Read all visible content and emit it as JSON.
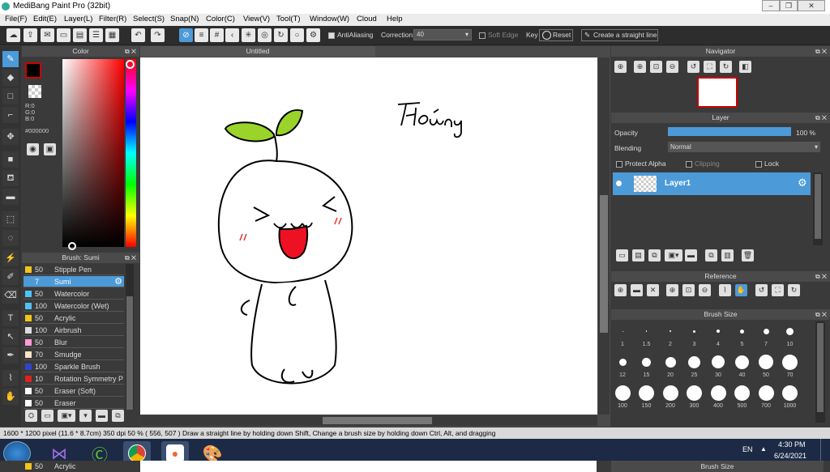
{
  "app": {
    "title": "MediBang Paint Pro (32bit)"
  },
  "menu": [
    "File(F)",
    "Edit(E)",
    "Layer(L)",
    "Filter(R)",
    "Select(S)",
    "Snap(N)",
    "Color(C)",
    "View(V)",
    "Tool(T)",
    "Window(W)",
    "Cloud",
    "Help"
  ],
  "toolbar": {
    "antialiasing_label": "AntiAliasing",
    "correction_label": "Correction",
    "correction_value": "40",
    "soft_edge_label": "Soft Edge",
    "key_label": "Key",
    "reset_label": "Reset",
    "straight_line_label": "Create a straight line"
  },
  "color_panel": {
    "title": "Color",
    "r": "R:0",
    "g": "G:0",
    "b": "B:0",
    "hex": "#000000",
    "primary_color": "#000000"
  },
  "brush_panel": {
    "title": "Brush: Sumi",
    "items": [
      {
        "size": "50",
        "name": "Stipple Pen",
        "color": "#f2c51c"
      },
      {
        "size": "7",
        "name": "Sumi",
        "color": "#4c9ad8",
        "selected": true
      },
      {
        "size": "50",
        "name": "Watercolor",
        "color": "#4fc3f7"
      },
      {
        "size": "100",
        "name": "Watercolor (Wet)",
        "color": "#4fc3f7"
      },
      {
        "size": "50",
        "name": "Acrylic",
        "color": "#f2c51c"
      },
      {
        "size": "100",
        "name": "Airbrush",
        "color": "#dddddd"
      },
      {
        "size": "50",
        "name": "Blur",
        "color": "#ff9bd6"
      },
      {
        "size": "70",
        "name": "Smudge",
        "color": "#ffe3c2"
      },
      {
        "size": "100",
        "name": "Sparkle Brush",
        "color": "#3344cc"
      },
      {
        "size": "10",
        "name": "Rotation Symmetry P",
        "color": "#dd2222"
      },
      {
        "size": "50",
        "name": "Eraser (Soft)",
        "color": "#ffffff"
      },
      {
        "size": "50",
        "name": "Eraser",
        "color": "#ffffff"
      }
    ]
  },
  "canvas": {
    "tab_title": "Untitled",
    "signature_text": "Hoàng"
  },
  "navigator": {
    "title": "Navigator"
  },
  "layer_panel": {
    "title": "Layer",
    "opacity_label": "Opacity",
    "opacity_value": "100 %",
    "opacity_fraction": 1.0,
    "blending_label": "Blending",
    "blending_value": "Normal",
    "protect_alpha_label": "Protect Alpha",
    "clipping_label": "Clipping",
    "lock_label": "Lock",
    "layer_name": "Layer1"
  },
  "reference": {
    "title": "Reference"
  },
  "brush_size": {
    "title": "Brush Size",
    "row1": [
      "1",
      "1.5",
      "2",
      "3",
      "4",
      "5",
      "7",
      "10"
    ],
    "row2": [
      "12",
      "15",
      "20",
      "25",
      "30",
      "40",
      "50",
      "70"
    ],
    "row3": [
      "100",
      "150",
      "200",
      "300",
      "400",
      "500",
      "700",
      "1000"
    ]
  },
  "status": {
    "text": "1600 * 1200 pixel  (11.6 * 8.7cm)  350 dpi  50 %  ( 556, 507 )  Draw a straight line by holding down Shift, Change a brush size by holding down Ctrl, Alt, and dragging"
  },
  "taskbar": {
    "lang": "EN",
    "time": "4:30 PM",
    "date": "6/24/2021"
  },
  "bottom_strip": {
    "size": "50",
    "name": "Acrylic",
    "panel": "Brush Size"
  }
}
